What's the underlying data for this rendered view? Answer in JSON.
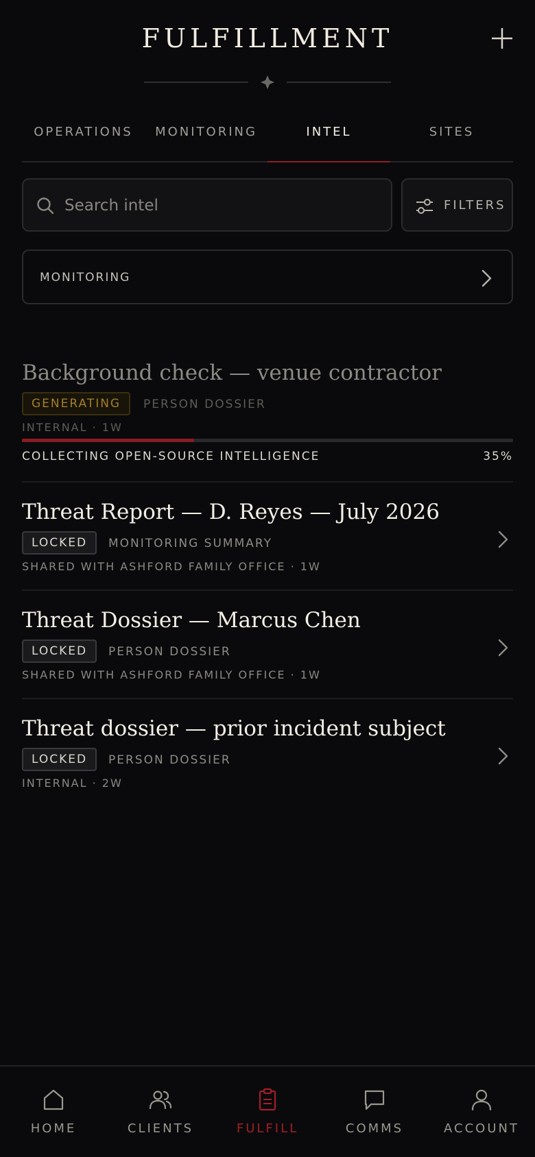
{
  "header": {
    "title": "FULFILLMENT"
  },
  "tabs": [
    {
      "label": "OPERATIONS"
    },
    {
      "label": "MONITORING"
    },
    {
      "label": "INTEL"
    },
    {
      "label": "SITES"
    }
  ],
  "active_tab": "INTEL",
  "search": {
    "placeholder": "Search intel",
    "value": ""
  },
  "filters": {
    "label": "FILTERS"
  },
  "monitoring_link": {
    "label": "MONITORING"
  },
  "items": [
    {
      "title": "Background check — venue contractor",
      "status": "GENERATING",
      "kind": "PERSON DOSSIER",
      "meta": "INTERNAL · 1W",
      "progress_label": "COLLECTING OPEN-SOURCE INTELLIGENCE",
      "progress_text": "35%",
      "progress": 0.35
    },
    {
      "title": "Threat Report — D. Reyes — July 2026",
      "status": "LOCKED",
      "kind": "MONITORING SUMMARY",
      "meta": "SHARED WITH ASHFORD FAMILY OFFICE · 1W"
    },
    {
      "title": "Threat Dossier — Marcus Chen",
      "status": "LOCKED",
      "kind": "PERSON DOSSIER",
      "meta": "SHARED WITH ASHFORD FAMILY OFFICE · 1W"
    },
    {
      "title": "Threat dossier — prior incident subject",
      "status": "LOCKED",
      "kind": "PERSON DOSSIER",
      "meta": "INTERNAL · 2W"
    }
  ],
  "bottom_nav": [
    {
      "label": "HOME",
      "icon": "home-icon"
    },
    {
      "label": "CLIENTS",
      "icon": "users-icon"
    },
    {
      "label": "FULFILL",
      "icon": "clipboard-icon"
    },
    {
      "label": "COMMS",
      "icon": "chat-icon"
    },
    {
      "label": "ACCOUNT",
      "icon": "user-icon"
    }
  ],
  "active_nav": "FULFILL",
  "colors": {
    "background": "#0a0a0c",
    "accent": "#8f1e24",
    "generating": "#a37f29",
    "text": "#f3efe6"
  }
}
